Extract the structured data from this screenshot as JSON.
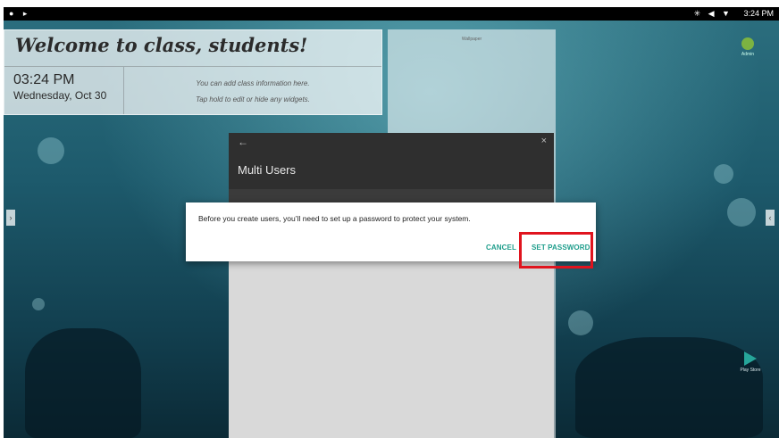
{
  "status_bar": {
    "left_icons": "● ▸",
    "right_icons": "✳ ◀ ▼",
    "time": "3:24 PM"
  },
  "welcome": {
    "title": "Welcome to class, students!",
    "time": "03:24 PM",
    "date": "Wednesday, Oct 30",
    "info_line1": "You can add class information here.",
    "info_line2": "Tap hold to edit or hide any widgets."
  },
  "wallpaper_card": {
    "title": "Wallpaper"
  },
  "account": {
    "label": "Admin"
  },
  "play_store": {
    "label": "Play Store"
  },
  "panel": {
    "title": "Multi Users",
    "back_icon": "←",
    "close_icon": "×"
  },
  "dialog": {
    "message": "Before you create users, you’ll need to set up a password to protect your system.",
    "cancel_label": "CANCEL",
    "set_password_label": "SET PASSWORD"
  },
  "side_arrows": {
    "left": "›",
    "right": "‹"
  },
  "colors": {
    "accent": "#1f9e8c",
    "highlight": "#e0141e",
    "panel_header": "#2f2f2f"
  }
}
